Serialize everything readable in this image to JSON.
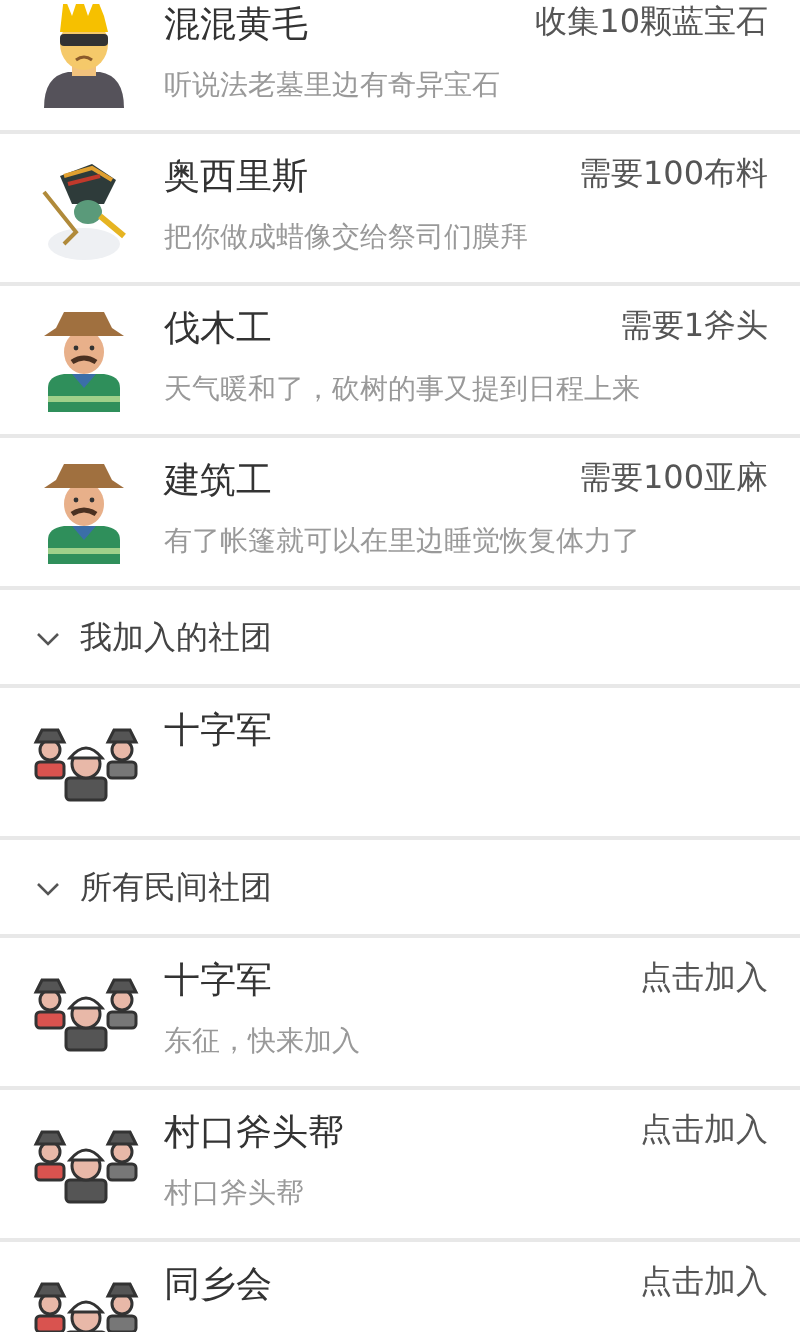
{
  "npcs": [
    {
      "kind": "punk",
      "name": "混混黄毛",
      "task": "收集10颗蓝宝石",
      "desc": "听说法老墓里边有奇异宝石"
    },
    {
      "kind": "pharaoh",
      "name": "奥西里斯",
      "task": "需要100布料",
      "desc": "把你做成蜡像交给祭司们膜拜"
    },
    {
      "kind": "worker",
      "name": "伐木工",
      "task": "需要1斧头",
      "desc": "天气暖和了，砍树的事又提到日程上来"
    },
    {
      "kind": "worker",
      "name": "建筑工",
      "task": "需要100亚麻",
      "desc": "有了帐篷就可以在里边睡觉恢复体力了"
    }
  ],
  "sections": [
    {
      "title": "我加入的社团",
      "expanded": true,
      "clubs": [
        {
          "kind": "group",
          "name": "十字军"
        }
      ]
    },
    {
      "title": "所有民间社团",
      "expanded": true,
      "clubs": [
        {
          "kind": "group",
          "name": "十字军",
          "desc": "东征，快来加入",
          "action": "点击加入"
        },
        {
          "kind": "group",
          "name": "村口斧头帮",
          "desc": "村口斧头帮",
          "action": "点击加入"
        },
        {
          "kind": "group",
          "name": "同乡会",
          "action": "点击加入"
        }
      ]
    }
  ]
}
